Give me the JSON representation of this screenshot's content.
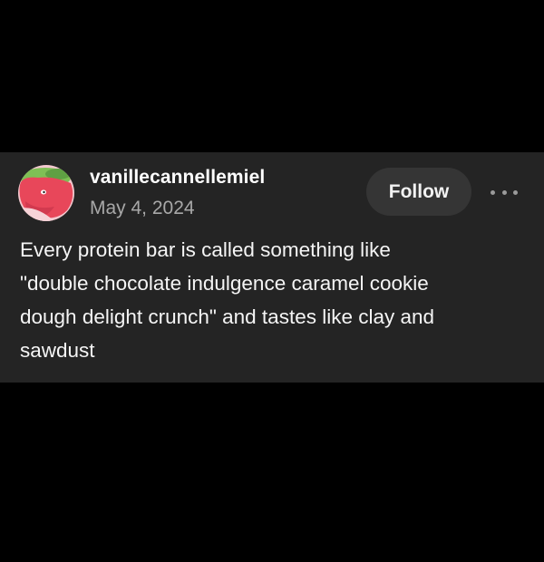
{
  "post": {
    "author": {
      "username": "vanillecannellemiel",
      "avatar_icon": "strawberry-avatar-icon"
    },
    "date": "May 4, 2024",
    "follow_label": "Follow",
    "more_icon": "ellipsis-icon",
    "body_lines": [
      "Every protein bar is called something like",
      "\"double chocolate indulgence caramel cookie",
      "dough delight crunch\" and tastes like clay and",
      "sawdust"
    ]
  },
  "colors": {
    "page_background": "#000000",
    "card_background": "#242424",
    "follow_button_background": "#353535",
    "secondary_text": "#a8a8a8"
  }
}
